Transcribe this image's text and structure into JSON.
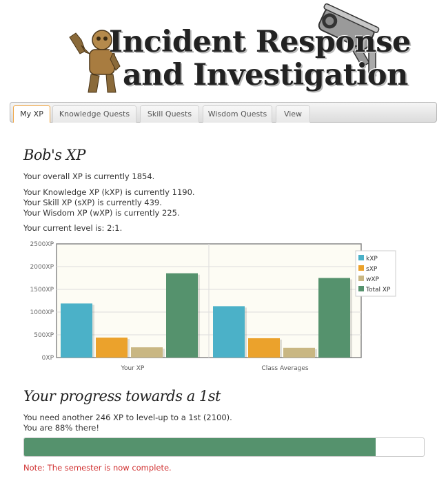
{
  "header": {
    "title_line1": "Incident Response",
    "title_line2": "and Investigation"
  },
  "tabs": [
    {
      "label": "My XP",
      "active": true
    },
    {
      "label": "Knowledge Quests",
      "active": false
    },
    {
      "label": "Skill Quests",
      "active": false
    },
    {
      "label": "Wisdom Quests",
      "active": false
    },
    {
      "label": "View",
      "active": false
    }
  ],
  "profile": {
    "heading": "Bob's XP",
    "overall": "Your overall XP is currently 1854.",
    "knowledge": "Your Knowledge XP (kXP) is currently 1190.",
    "skill": "Your Skill XP (sXP) is currently 439.",
    "wisdom": "Your Wisdom XP (wXP) is currently 225.",
    "level": "Your current level is: 2:1."
  },
  "chart_data": {
    "type": "bar",
    "categories": [
      "Your XP",
      "Class Averages"
    ],
    "series": [
      {
        "name": "kXP",
        "values": [
          1190,
          1130
        ],
        "color": "#4bb1c8"
      },
      {
        "name": "sXP",
        "values": [
          439,
          425
        ],
        "color": "#eba22c"
      },
      {
        "name": "wXP",
        "values": [
          225,
          215
        ],
        "color": "#c9b783"
      },
      {
        "name": "Total XP",
        "values": [
          1854,
          1750
        ],
        "color": "#55926d"
      }
    ],
    "yticks": [
      "0XP",
      "500XP",
      "1000XP",
      "1500XP",
      "2000XP",
      "2500XP"
    ],
    "ylim": [
      0,
      2500
    ],
    "grid": true,
    "legend": "right"
  },
  "progress": {
    "heading": "Your progress towards a 1st",
    "need": "You need another 246 XP to level-up to a 1st (2100).",
    "percent_text": "You are 88% there!",
    "percent": 88,
    "color": "#55926d"
  },
  "note": "Note: The semester is now complete."
}
